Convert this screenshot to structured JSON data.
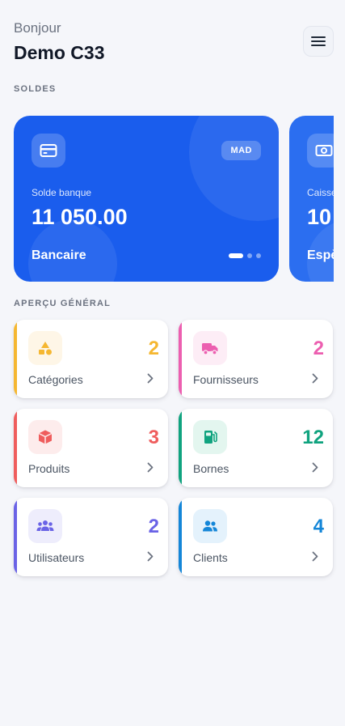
{
  "header": {
    "greeting": "Bonjour",
    "user_name": "Demo C33",
    "menu_icon": "hamburger-menu-icon"
  },
  "sections": {
    "balances": "SOLDES",
    "overview": "APERÇU GÉNÉRAL"
  },
  "balances": [
    {
      "label": "Solde banque",
      "amount": "11 050.00",
      "type": "Bancaire",
      "currency": "MAD",
      "icon": "credit-card-icon",
      "color": "#1a5ded"
    },
    {
      "label": "Caisse",
      "amount": "10",
      "type": "Espè",
      "icon": "cash-icon",
      "color": "#2b6ef0"
    }
  ],
  "carousel": {
    "pages": 3,
    "active": 0
  },
  "stats": [
    {
      "label": "Catégories",
      "count": "2",
      "icon": "shapes-icon",
      "color": "#f5b731",
      "bg": "#fef6e7"
    },
    {
      "label": "Fournisseurs",
      "count": "2",
      "icon": "truck-icon",
      "color": "#ec5fb0",
      "bg": "#fdedf6"
    },
    {
      "label": "Produits",
      "count": "3",
      "icon": "box-icon",
      "color": "#ef5d5d",
      "bg": "#fdecec"
    },
    {
      "label": "Bornes",
      "count": "12",
      "icon": "fuel-pump-icon",
      "color": "#10a37f",
      "bg": "#e3f6ef"
    },
    {
      "label": "Utilisateurs",
      "count": "2",
      "icon": "users-group-icon",
      "color": "#6a63e6",
      "bg": "#eeedfc"
    },
    {
      "label": "Clients",
      "count": "4",
      "icon": "users-icon",
      "color": "#1486d8",
      "bg": "#e4f2fc"
    }
  ]
}
